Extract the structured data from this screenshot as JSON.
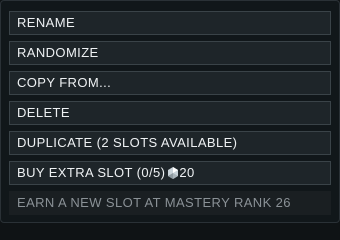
{
  "menu": {
    "rename_label": "RENAME",
    "randomize_label": "RANDOMIZE",
    "copy_from_label": "COPY FROM...",
    "delete_label": "DELETE",
    "duplicate_label": "DUPLICATE (2 SLOTS AVAILABLE)",
    "buy_slot_label": "BUY EXTRA SLOT (0/5)",
    "buy_slot_price": "20",
    "buy_slot_currency_icon": "platinum-icon",
    "earn_slot_label": "EARN A NEW SLOT AT MASTERY RANK 26"
  },
  "colors": {
    "panel_bg": "#11171a",
    "item_bg": "#1e2529",
    "item_border": "#3a4348",
    "text": "#eef1f3",
    "disabled_text": "#8a9196"
  }
}
